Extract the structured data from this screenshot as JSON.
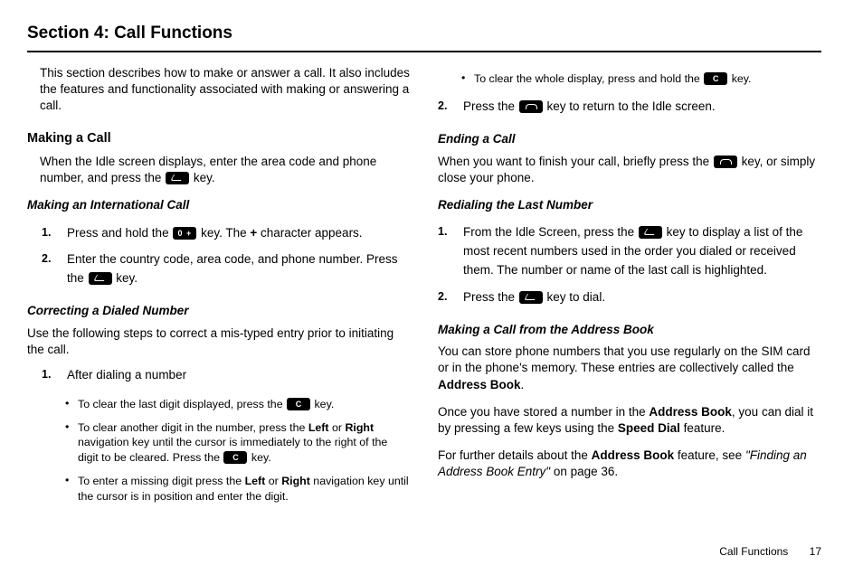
{
  "section_title": "Section 4: Call Functions",
  "left": {
    "intro": "This section describes how to make or answer a call. It also includes the features and functionality associated with making or answering a call.",
    "making_call_h": "Making a Call",
    "making_call_p1a": "When the Idle screen displays, enter the area code and phone number, and press the ",
    "making_call_p1b": " key.",
    "intl_h": "Making an International Call",
    "intl_s1a": "Press and hold the ",
    "intl_s1b": " key. The ",
    "intl_s1c": "+",
    "intl_s1d": " character appears.",
    "intl_s2a": "Enter the country code, area code, and phone number. Press the ",
    "intl_s2b": " key.",
    "correct_h": "Correcting a Dialed Number",
    "correct_p": "Use the following steps to correct a mis-typed entry prior to initiating the call.",
    "correct_s1": "After dialing a number",
    "correct_b1a": "To clear the last digit displayed, press the ",
    "correct_b1b": " key.",
    "correct_b2a": "To clear another digit in the number, press the ",
    "correct_b2_left": "Left",
    "correct_b2_or": " or ",
    "correct_b2_right": "Right",
    "correct_b2b": " navigation key until the cursor is immediately to the right of the digit to be cleared. Press the ",
    "correct_b2c": " key.",
    "correct_b3a": "To enter a missing digit press the ",
    "correct_b3_left": "Left",
    "correct_b3_or": " or ",
    "correct_b3_right": "Right",
    "correct_b3b": " navigation key until the cursor is in position and enter the digit."
  },
  "right": {
    "b1a": "To clear the whole display, press and hold the ",
    "b1b": " key.",
    "s2a": "Press the ",
    "s2b": " key to return to the Idle screen.",
    "end_h": "Ending a Call",
    "end_p1a": "When you want to finish your call, briefly press the ",
    "end_p1b": " key, or simply close your phone.",
    "redial_h": "Redialing the Last Number",
    "redial_s1a": "From the Idle Screen, press the ",
    "redial_s1b": " key to display a list of the most recent numbers used in the order you dialed or received them. The number or name of the last call is highlighted.",
    "redial_s2a": "Press the ",
    "redial_s2b": " key to dial.",
    "ab_h": "Making a Call from the Address Book",
    "ab_p1a": "You can store phone numbers that you use regularly on the SIM card or in the phone's memory. These entries are collectively called the ",
    "ab_p1b": "Address Book",
    "ab_p1c": ".",
    "ab_p2a": "Once you have stored a number in the ",
    "ab_p2b": "Address Book",
    "ab_p2c": ", you can dial it by pressing a few keys using the ",
    "ab_p2d": "Speed Dial",
    "ab_p2e": " feature.",
    "ab_p3a": "For further details about the ",
    "ab_p3b": "Address Book",
    "ab_p3c": " feature, see ",
    "ab_p3d": "\"Finding an Address Book Entry\"",
    "ab_p3e": " on page 36."
  },
  "footer": {
    "label": "Call Functions",
    "page": "17"
  },
  "numbers": {
    "one": "1.",
    "two": "2."
  }
}
